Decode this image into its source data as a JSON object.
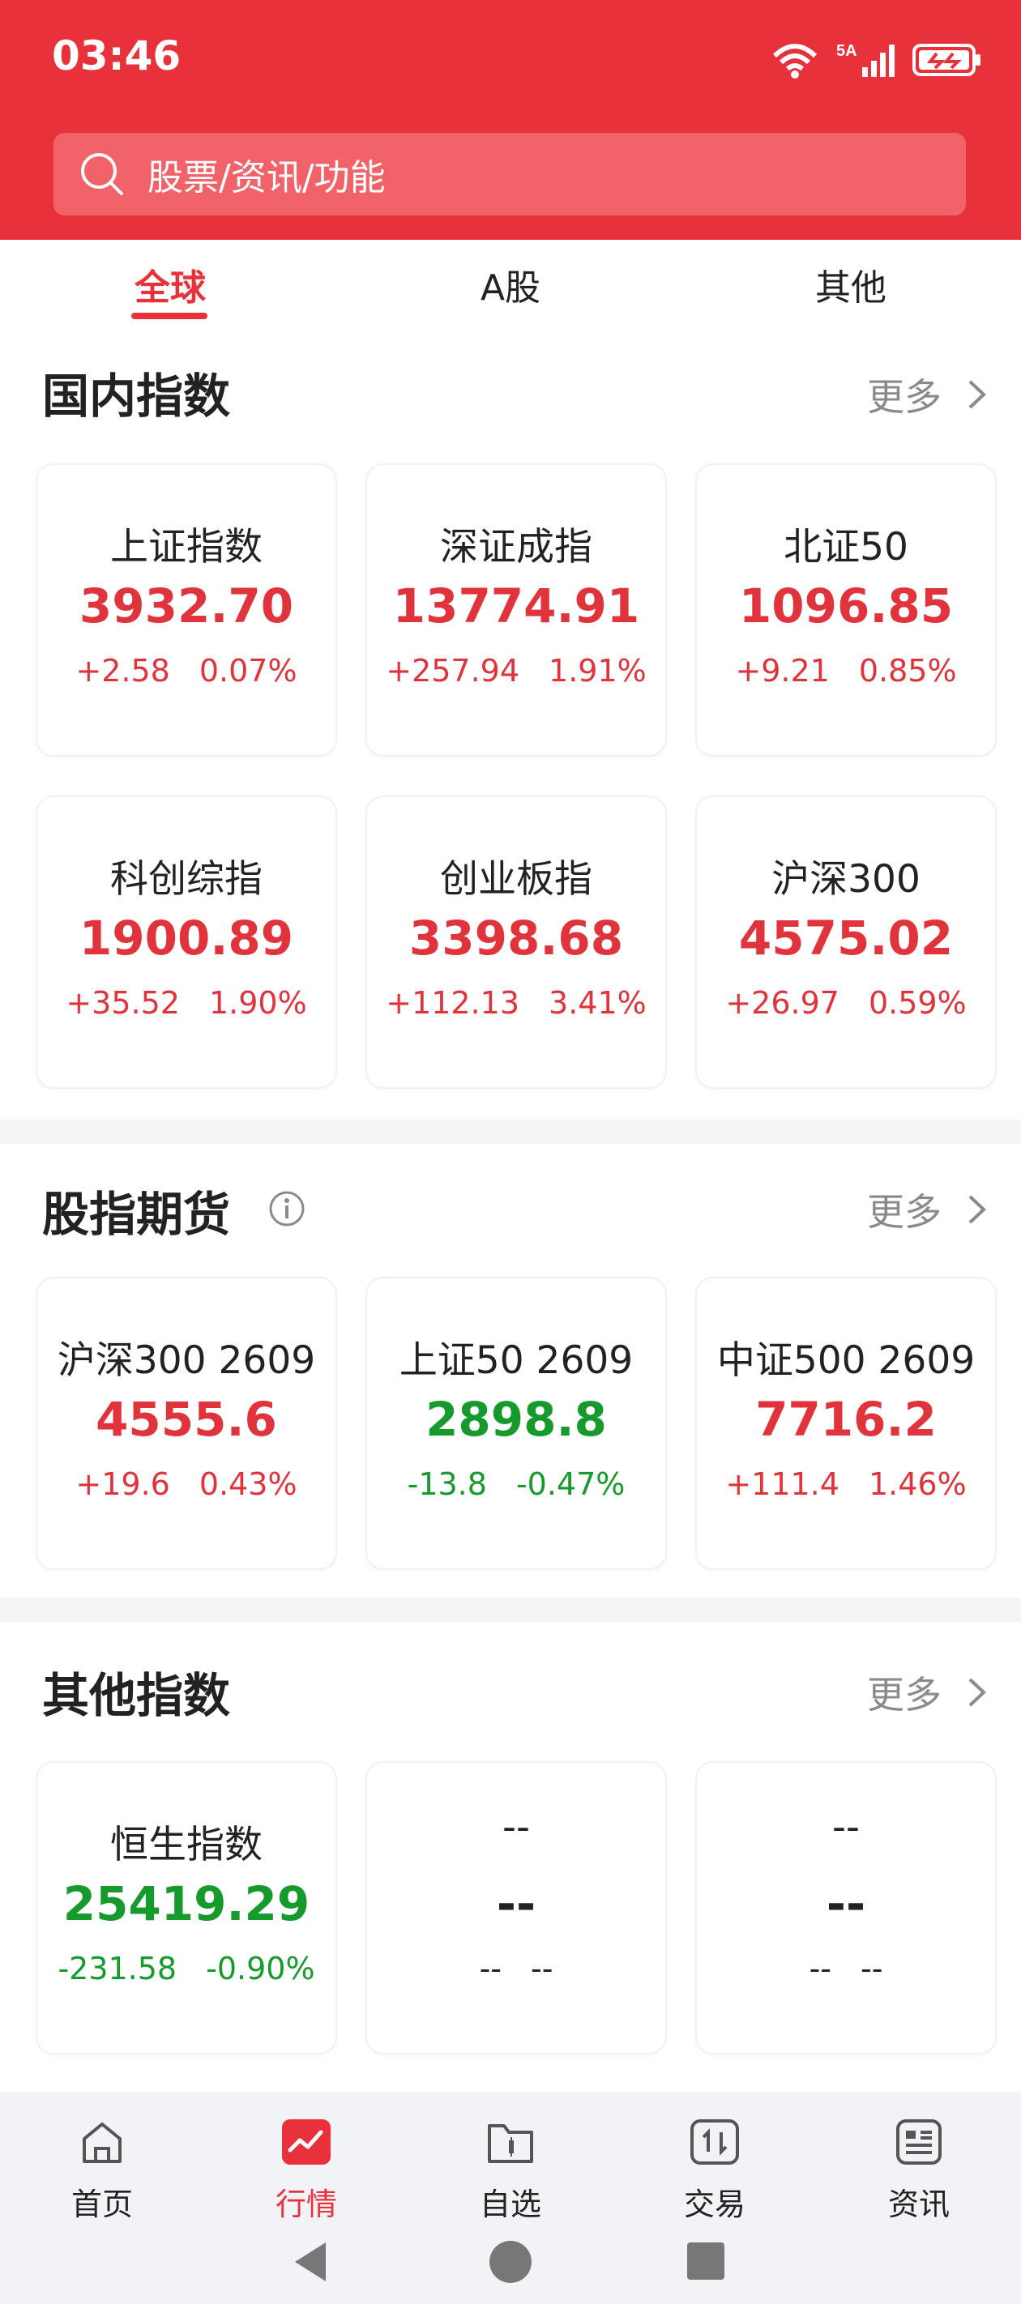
{
  "status_bar": {
    "time": "03:46",
    "network": "6",
    "signal": "5A"
  },
  "search": {
    "placeholder": "股票/资讯/功能"
  },
  "tabs": [
    {
      "label": "全球",
      "active": true
    },
    {
      "label": "A股",
      "active": false
    },
    {
      "label": "其他",
      "active": false
    }
  ],
  "domestic": {
    "title": "国内指数",
    "more": "更多",
    "items": [
      {
        "name": "上证指数",
        "price": "3932.70",
        "change": "+2.58",
        "pct": "0.07%",
        "trend": "up"
      },
      {
        "name": "深证成指",
        "price": "13774.91",
        "change": "+257.94",
        "pct": "1.91%",
        "trend": "up"
      },
      {
        "name": "北证50",
        "price": "1096.85",
        "change": "+9.21",
        "pct": "0.85%",
        "trend": "up"
      },
      {
        "name": "科创综指",
        "price": "1900.89",
        "change": "+35.52",
        "pct": "1.90%",
        "trend": "up"
      },
      {
        "name": "创业板指",
        "price": "3398.68",
        "change": "+112.13",
        "pct": "3.41%",
        "trend": "up"
      },
      {
        "name": "沪深300",
        "price": "4575.02",
        "change": "+26.97",
        "pct": "0.59%",
        "trend": "up"
      }
    ]
  },
  "futures": {
    "title": "股指期货",
    "more": "更多",
    "items": [
      {
        "name": "沪深300 2609",
        "price": "4555.6",
        "change": "+19.6",
        "pct": "0.43%",
        "trend": "up"
      },
      {
        "name": "上证50 2609",
        "price": "2898.8",
        "change": "-13.8",
        "pct": "-0.47%",
        "trend": "down"
      },
      {
        "name": "中证500 2609",
        "price": "7716.2",
        "change": "+111.4",
        "pct": "1.46%",
        "trend": "up"
      }
    ]
  },
  "others": {
    "title": "其他指数",
    "more": "更多",
    "items": [
      {
        "name": "恒生指数",
        "price": "25419.29",
        "change": "-231.58",
        "pct": "-0.90%",
        "trend": "down"
      },
      {
        "name": "--",
        "price": "--",
        "change": "--",
        "pct": "--",
        "trend": "flat"
      },
      {
        "name": "--",
        "price": "--",
        "change": "--",
        "pct": "--",
        "trend": "flat"
      }
    ]
  },
  "bottom_nav": [
    {
      "label": "首页",
      "icon": "home-icon",
      "active": false
    },
    {
      "label": "行情",
      "icon": "market-chart-icon",
      "active": true
    },
    {
      "label": "自选",
      "icon": "watchlist-folder-icon",
      "active": false
    },
    {
      "label": "交易",
      "icon": "trade-icon",
      "active": false
    },
    {
      "label": "资讯",
      "icon": "news-icon",
      "active": false
    }
  ],
  "colors": {
    "brand_red": "#e8313a",
    "up": "#e1333b",
    "down": "#169a2c"
  }
}
